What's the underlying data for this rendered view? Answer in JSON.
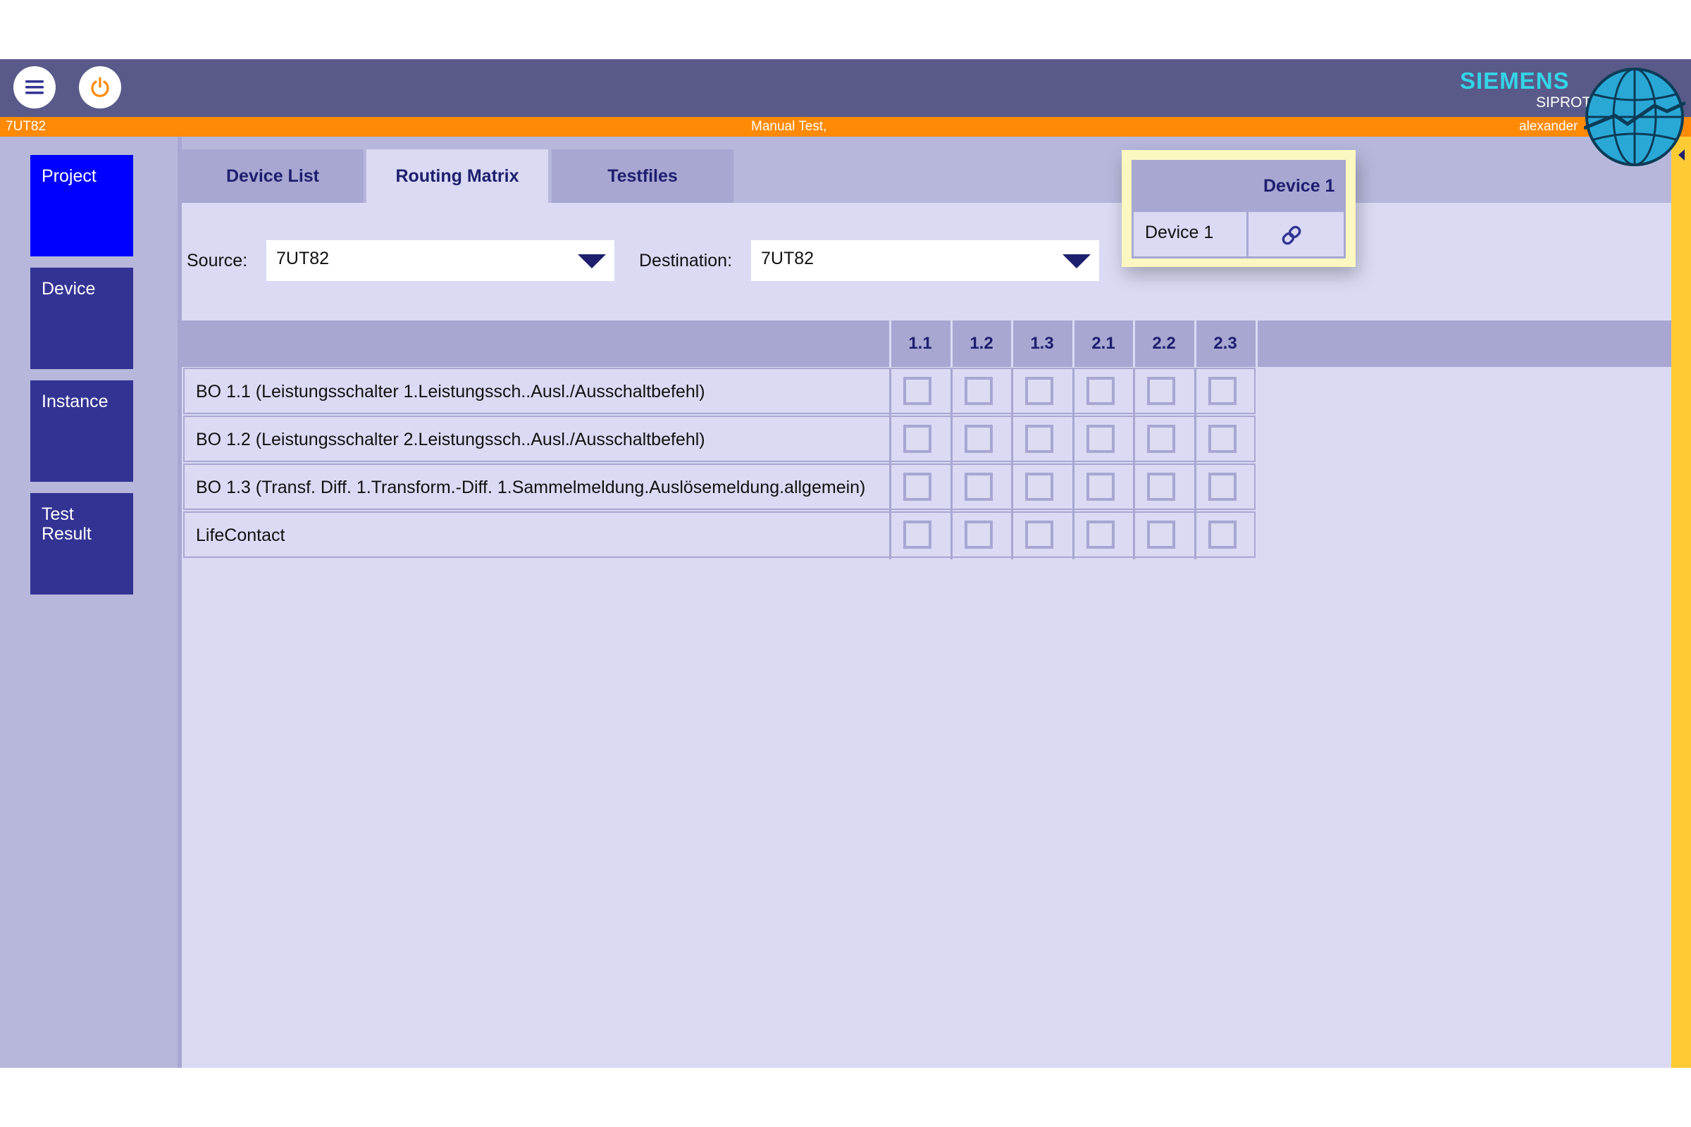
{
  "header": {
    "menu_icon": "hamburger-icon",
    "power_icon": "power-icon",
    "brand": "SIEMENS",
    "app_name": "SIPROT",
    "colors": {
      "header": "#595a8a",
      "status_bar": "#ff8a06",
      "brand": "#33d5e6",
      "accent": "#fecb35"
    }
  },
  "status_bar": {
    "device": "7UT82",
    "mode": "Manual Test,",
    "user": "alexander"
  },
  "sidebar": {
    "items": [
      {
        "label": "Project",
        "active": true
      },
      {
        "label": "Device",
        "active": false
      },
      {
        "label": "Instance",
        "active": false
      },
      {
        "label": "Test Result",
        "active": false
      }
    ]
  },
  "tabs": [
    {
      "label": "Device List",
      "active": false
    },
    {
      "label": "Routing Matrix",
      "active": true
    },
    {
      "label": "Testfiles",
      "active": false
    }
  ],
  "routing": {
    "source_label": "Source:",
    "source_value": "7UT82",
    "destination_label": "Destination:",
    "destination_value": "7UT82"
  },
  "matrix": {
    "columns": [
      "1.1",
      "1.2",
      "1.3",
      "2.1",
      "2.2",
      "2.3"
    ],
    "rows": [
      {
        "label": "BO 1.1 (Leistungsschalter 1.Leistungssch..Ausl./Ausschaltbefehl)",
        "checked": [
          false,
          false,
          false,
          false,
          false,
          false
        ]
      },
      {
        "label": "BO 1.2 (Leistungsschalter 2.Leistungssch..Ausl./Ausschaltbefehl)",
        "checked": [
          false,
          false,
          false,
          false,
          false,
          false
        ]
      },
      {
        "label": "BO 1.3 (Transf. Diff. 1.Transform.-Diff. 1.Sammelmeldung.Auslösemeldung.allgemein)",
        "checked": [
          false,
          false,
          false,
          false,
          false,
          false
        ]
      },
      {
        "label": "LifeContact",
        "checked": [
          false,
          false,
          false,
          false,
          false,
          false
        ]
      }
    ]
  },
  "popup": {
    "column_header": "Device 1",
    "row_label": "Device 1",
    "cell_icon": "link-icon"
  }
}
